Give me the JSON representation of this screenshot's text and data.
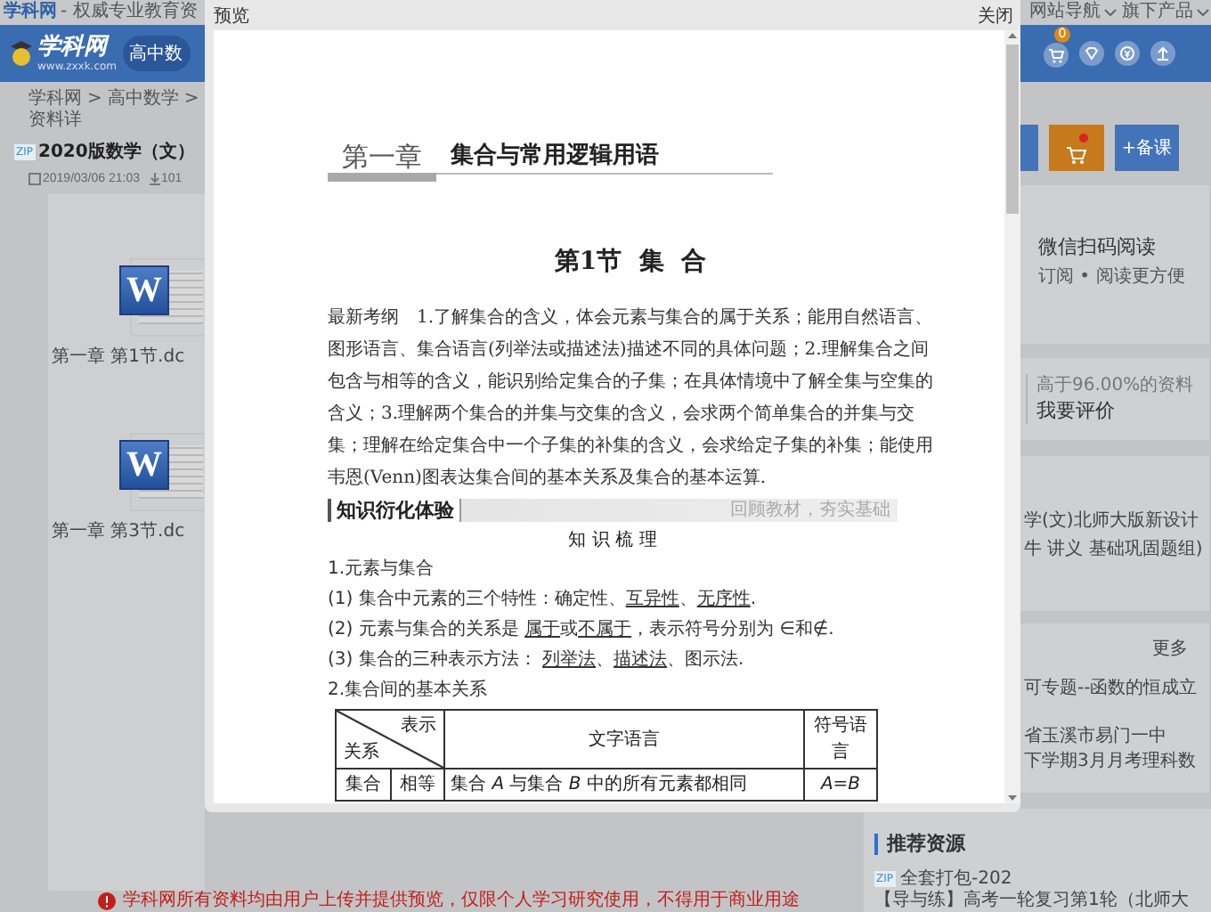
{
  "top_bar": {
    "site_name": "学科网",
    "tagline": "- 权威专业教育资",
    "links": [
      "网站导航",
      "旗下产品"
    ]
  },
  "header": {
    "logo": "学科网",
    "logo_url": "www.zxxk.com",
    "subject_button": "高中数",
    "cart_count": "0"
  },
  "breadcrumb": [
    {
      "label": "学科网",
      "separator": ">"
    },
    {
      "label": "高中数学",
      "separator": ">"
    },
    {
      "label": "资料详"
    }
  ],
  "resource": {
    "type_badge": "ZIP",
    "title": "2020版数学（文）",
    "date": "2019/03/06 21:03",
    "downloads": "101"
  },
  "files": [
    {
      "name": "第一章 第1节.dc",
      "icon_letter": "W"
    },
    {
      "name": "第一章 第3节.dc",
      "icon_letter": "W"
    }
  ],
  "actions": [
    {
      "kind": "blank"
    },
    {
      "kind": "cart"
    },
    {
      "kind": "text",
      "label": "+备课"
    }
  ],
  "wechat_card": {
    "title": "微信扫码阅读",
    "subtitle": "订阅 • 阅读更方便"
  },
  "rating_card": {
    "note": "高于96.00%的资料",
    "action": "我要评价"
  },
  "series_card": {
    "lines": [
      "学(文)北师大版新设计",
      "牛 讲义 基础巩固题组)"
    ]
  },
  "related_card": {
    "more": "更多",
    "items": [
      {
        "lines": [
          "可专题--函数的恒成立"
        ]
      },
      {
        "lines": [
          "省玉溪市易门一中",
          "下学期3月月考理科数"
        ]
      }
    ]
  },
  "recommended": {
    "title": "推荐资源",
    "items": [
      {
        "badge": "ZIP",
        "title": "全套打包-202"
      },
      {
        "title": "【导与练】高考一轮复习第1轮（北师大"
      }
    ]
  },
  "notice": "学科网所有资料均由用户上传并提供预览，仅限个人学习研究使用，不得用于商业用途",
  "preview": {
    "title": "预览",
    "close": "关闭",
    "document": {
      "chapter_number": "第一章",
      "chapter_title": "集合与常用逻辑用语",
      "section_title": "第1节  集  合",
      "syllabus": "最新考纲　1.了解集合的含义，体会元素与集合的属于关系；能用自然语言、图形语言、集合语言(列举法或描述法)描述不同的具体问题；2.理解集合之间包含与相等的含义，能识别给定集合的子集；在具体情境中了解全集与空集的含义；3.理解两个集合的并集与交集的含义，会求两个简单集合的并集与交集；理解在给定集合中一个子集的补集的含义，会求给定子集的补集；能使用韦恩(Venn)图表达集合间的基本关系及集合的基本运算.",
      "banner": {
        "title": "知识衍化体验",
        "note": "回顾教材，夯实基础"
      },
      "subheading": "知 识 梳 理",
      "lines": [
        {
          "segments": [
            {
              "text": "1.元素与集合",
              "underline": false
            }
          ]
        },
        {
          "segments": [
            {
              "text": "(1) 集合中元素的三个特性：确定性、",
              "underline": false
            },
            {
              "text": "互异性",
              "underline": true
            },
            {
              "text": "、",
              "underline": false
            },
            {
              "text": "无序性",
              "underline": true
            },
            {
              "text": ".",
              "underline": false
            }
          ]
        },
        {
          "segments": [
            {
              "text": "(2) 元素与集合的关系是 ",
              "underline": false
            },
            {
              "text": "属于",
              "underline": true
            },
            {
              "text": "或",
              "underline": false
            },
            {
              "text": "不属于",
              "underline": true
            },
            {
              "text": "，表示符号分别为 ∈和∉.",
              "underline": false
            }
          ]
        },
        {
          "segments": [
            {
              "text": "(3) 集合的三种表示方法： ",
              "underline": false
            },
            {
              "text": "列举法",
              "underline": true
            },
            {
              "text": "、",
              "underline": false
            },
            {
              "text": "描述法",
              "underline": true
            },
            {
              "text": "、图示法.",
              "underline": false
            }
          ]
        },
        {
          "segments": [
            {
              "text": "2.集合间的基本关系",
              "underline": false
            }
          ]
        }
      ],
      "table": {
        "columns": [
          "关系",
          "表示",
          "文字语言",
          "符号语言"
        ],
        "rows": [
          {
            "cells": [
              "集合",
              "相等",
              "集合 *A* 与集合 *B* 中的所有元素都相同",
              "*A*=*B*"
            ]
          }
        ]
      }
    }
  }
}
